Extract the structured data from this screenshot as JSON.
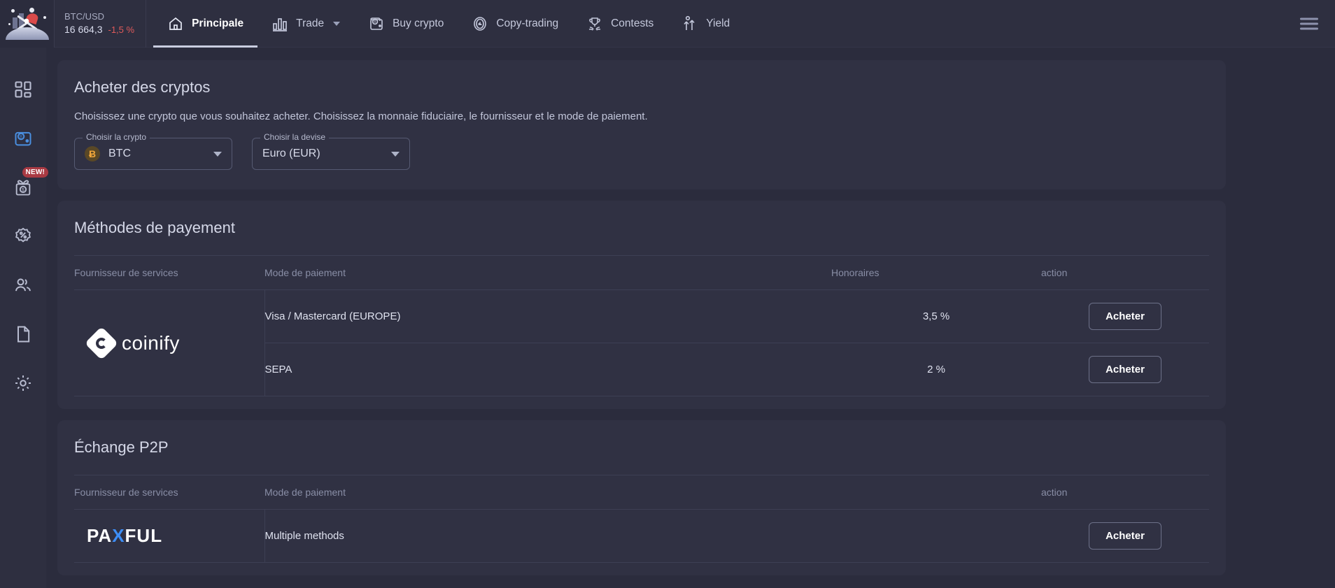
{
  "topbar": {
    "logo_name": "exchange-logo",
    "ticker": {
      "pair": "BTC/USD",
      "price": "16 664,3",
      "change": "-1,5 %",
      "change_color": "#e05a5a"
    },
    "nav": [
      {
        "label": "Principale",
        "icon": "home-icon",
        "active": true,
        "caret": false
      },
      {
        "label": "Trade",
        "icon": "bar-chart-icon",
        "active": false,
        "caret": true
      },
      {
        "label": "Buy crypto",
        "icon": "wallet-bitcoin-icon",
        "active": false,
        "caret": false
      },
      {
        "label": "Copy-trading",
        "icon": "copy-trading-icon",
        "active": false,
        "caret": false
      },
      {
        "label": "Contests",
        "icon": "trophy-icon",
        "active": false,
        "caret": false
      },
      {
        "label": "Yield",
        "icon": "yield-arrows-icon",
        "active": false,
        "caret": false
      }
    ],
    "menu_icon": "hamburger-menu-icon"
  },
  "sidebar": {
    "items": [
      {
        "icon": "dashboard-grid-icon",
        "badge": ""
      },
      {
        "icon": "wallet-bitcoin-icon",
        "badge": ""
      },
      {
        "icon": "gift-money-icon",
        "badge": "NEW!"
      },
      {
        "icon": "percent-badge-icon",
        "badge": ""
      },
      {
        "icon": "users-icon",
        "badge": ""
      },
      {
        "icon": "document-icon",
        "badge": ""
      },
      {
        "icon": "gear-icon",
        "badge": ""
      }
    ]
  },
  "buy_card": {
    "title": "Acheter des cryptos",
    "subtitle": "Choisissez une crypto que vous souhaitez acheter. Choisissez la monnaie fiduciaire, le fournisseur et le mode de paiement.",
    "crypto_select": {
      "legend": "Choisir la crypto",
      "value": "BTC",
      "coin_symbol": "Ƀ"
    },
    "currency_select": {
      "legend": "Choisir la devise",
      "value": "Euro (EUR)"
    }
  },
  "payment_card": {
    "title": "Méthodes de payement",
    "columns": {
      "provider": "Fournisseur de services",
      "mode": "Mode de paiement",
      "fee": "Honoraires",
      "action": "action"
    },
    "provider_name": "coinify",
    "rows": [
      {
        "mode": "Visa / Mastercard (EUROPE)",
        "fee": "3,5 %",
        "action": "Acheter"
      },
      {
        "mode": "SEPA",
        "fee": "2 %",
        "action": "Acheter"
      }
    ]
  },
  "p2p_card": {
    "title": "Échange P2P",
    "columns": {
      "provider": "Fournisseur de services",
      "mode": "Mode de paiement",
      "action": "action"
    },
    "provider_name_1": "PA",
    "provider_name_x": "X",
    "provider_name_2": "FUL",
    "rows": [
      {
        "mode": "Multiple methods",
        "action": "Acheter"
      }
    ]
  },
  "colors": {
    "page_bg": "#2b2c3d",
    "card_bg": "#303143",
    "topbar_bg": "#2e2f40",
    "accent_blue": "#3d8ef7",
    "badge_red": "#a93a43",
    "text_primary": "#dfe2ef",
    "text_muted": "#898ea6"
  }
}
